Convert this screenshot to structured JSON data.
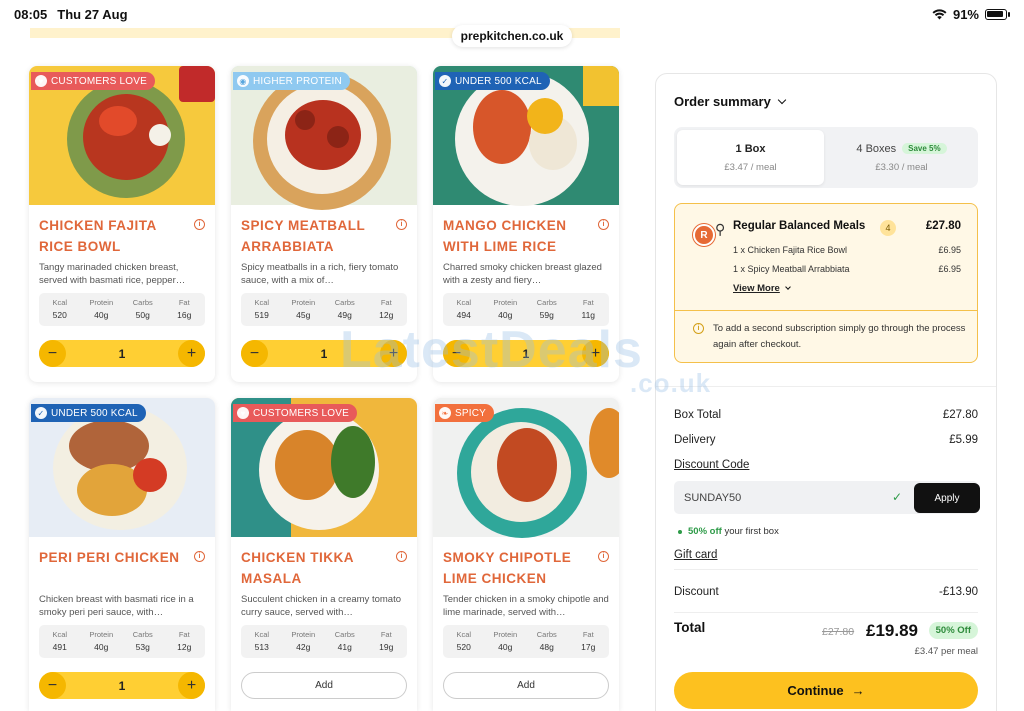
{
  "status_bar": {
    "time": "08:05",
    "date": "Thu 27 Aug",
    "battery": "91%"
  },
  "url": "prepkitchen.co.uk",
  "nutrition_labels": {
    "kcal": "Kcal",
    "protein": "Protein",
    "carbs": "Carbs",
    "fat": "Fat"
  },
  "meals": [
    {
      "badge": "CUSTOMERS LOVE",
      "badge_color": "#e85a5a",
      "title": "CHICKEN FAJITA RICE BOWL",
      "desc": "Tangy marinaded chicken breast, served with basmati rice, pepper…",
      "kcal": "520",
      "protein": "40g",
      "carbs": "50g",
      "fat": "16g",
      "qty": "1",
      "has_stepper": true
    },
    {
      "badge": "HIGHER PROTEIN",
      "badge_color": "#8fc9f0",
      "title": "SPICY MEATBALL ARRABBIATA",
      "desc": "Spicy meatballs in a rich, fiery tomato sauce, with a mix of…",
      "kcal": "519",
      "protein": "45g",
      "carbs": "49g",
      "fat": "12g",
      "qty": "1",
      "has_stepper": true
    },
    {
      "badge": "UNDER 500 KCAL",
      "badge_color": "#1f63b5",
      "title": "MANGO CHICKEN WITH LIME RICE",
      "desc": "Charred smoky chicken breast glazed with a zesty and fiery…",
      "kcal": "494",
      "protein": "40g",
      "carbs": "59g",
      "fat": "11g",
      "qty": "1",
      "has_stepper": true
    },
    {
      "badge": "UNDER 500 KCAL",
      "badge_color": "#1f63b5",
      "title": "PERI PERI CHICKEN",
      "desc": "Chicken breast with basmati rice in a smoky peri peri sauce, with…",
      "kcal": "491",
      "protein": "40g",
      "carbs": "53g",
      "fat": "12g",
      "qty": "1",
      "has_stepper": true
    },
    {
      "badge": "CUSTOMERS LOVE",
      "badge_color": "#e85a5a",
      "title": "CHICKEN TIKKA MASALA",
      "desc": "Succulent chicken in a creamy tomato curry sauce, served with…",
      "kcal": "513",
      "protein": "42g",
      "carbs": "41g",
      "fat": "19g",
      "add_label": "Add",
      "has_stepper": false
    },
    {
      "badge": "SPICY",
      "badge_color": "#f2703d",
      "title": "SMOKY CHIPOTLE LIME CHICKEN",
      "desc": "Tender chicken in a smoky chipotle and lime marinade, served with…",
      "kcal": "520",
      "protein": "40g",
      "carbs": "48g",
      "fat": "17g",
      "add_label": "Add",
      "has_stepper": false
    }
  ],
  "order": {
    "heading": "Order summary",
    "box_options": [
      {
        "label": "1 Box",
        "price": "£3.47 / meal"
      },
      {
        "label": "4 Boxes",
        "save": "Save 5%",
        "price": "£3.30 / meal"
      }
    ],
    "meals_title": "Regular Balanced Meals",
    "meals_count": "4",
    "meals_price": "£27.80",
    "lines": [
      {
        "name": "1 x Chicken Fajita Rice Bowl",
        "price": "£6.95"
      },
      {
        "name": "1 x Spicy Meatball Arrabbiata",
        "price": "£6.95"
      }
    ],
    "view_more": "View More",
    "note": "To add a second subscription simply go through the process again after checkout.",
    "box_total_label": "Box Total",
    "box_total": "£27.80",
    "delivery_label": "Delivery",
    "delivery": "£5.99",
    "discount_code_label": "Discount Code",
    "discount_code_value": "SUNDAY50",
    "apply_label": "Apply",
    "promo_bold": "50% off",
    "promo_rest": "your first box",
    "gift_card_label": "Gift card",
    "discount_label": "Discount",
    "discount": "-£13.90",
    "total_label": "Total",
    "old_total": "£27.80",
    "new_total": "£19.89",
    "off_badge": "50% Off",
    "per_meal": "£3.47 per meal",
    "continue_label": "Continue"
  },
  "watermark": {
    "main": "LatestDeals",
    "sub": ".co.uk"
  }
}
